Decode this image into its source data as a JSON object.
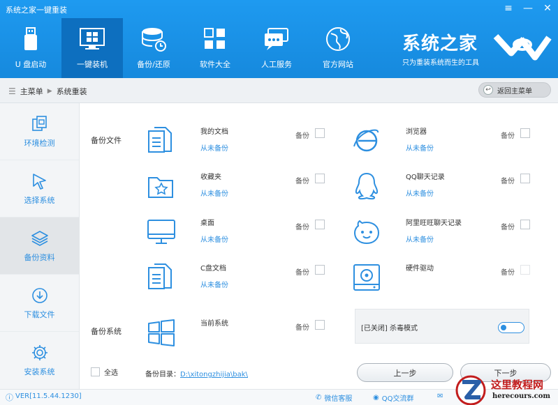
{
  "window": {
    "title": "系统之家一键重装"
  },
  "nav": [
    {
      "label": "U 盘启动",
      "icon": "usb-icon"
    },
    {
      "label": "一键装机",
      "icon": "monitor-windows-icon"
    },
    {
      "label": "备份/还原",
      "icon": "database-restore-icon"
    },
    {
      "label": "软件大全",
      "icon": "apps-grid-icon"
    },
    {
      "label": "人工服务",
      "icon": "chat-bubbles-icon"
    },
    {
      "label": "官方网站",
      "icon": "globe-icon"
    }
  ],
  "brand": {
    "name": "系统之家",
    "slogan": "只为重装系统而生的工具"
  },
  "breadcrumb": {
    "home": "主菜单",
    "current": "系统重装"
  },
  "back_button": "返回主菜单",
  "sidebar": [
    {
      "label": "环境检测",
      "icon": "copy-pages-icon"
    },
    {
      "label": "选择系统",
      "icon": "cursor-arrow-icon"
    },
    {
      "label": "备份资料",
      "icon": "layers-icon"
    },
    {
      "label": "下载文件",
      "icon": "download-circle-icon"
    },
    {
      "label": "安装系统",
      "icon": "gear-icon"
    }
  ],
  "backup_files": {
    "section_label": "备份文件",
    "backup_label": "备份",
    "items": [
      {
        "name": "我的文档",
        "status": "从未备份",
        "icon": "documents-icon"
      },
      {
        "name": "浏览器",
        "status": "从未备份",
        "icon": "ie-browser-icon"
      },
      {
        "name": "收藏夹",
        "status": "从未备份",
        "icon": "favorites-folder-icon"
      },
      {
        "name": "QQ聊天记录",
        "status": "从未备份",
        "icon": "qq-penguin-icon"
      },
      {
        "name": "桌面",
        "status": "从未备份",
        "icon": "desktop-monitor-icon"
      },
      {
        "name": "阿里旺旺聊天记录",
        "status": "从未备份",
        "icon": "wangwang-icon"
      },
      {
        "name": "C盘文档",
        "status": "从未备份",
        "icon": "c-drive-documents-icon"
      },
      {
        "name": "硬件驱动",
        "status": "",
        "icon": "hardware-driver-icon"
      }
    ]
  },
  "backup_system": {
    "section_label": "备份系统",
    "name": "当前系统",
    "backup_label": "备份",
    "icon": "windows-logo-icon"
  },
  "antivirus": {
    "text": "[已关闭] 杀毒模式"
  },
  "footer": {
    "select_all": "全选",
    "dir_label": "备份目录：",
    "dir_path": "D:\\xitongzhijia\\bak\\",
    "prev_button": "上一步",
    "next_button": "下一步"
  },
  "statusbar": {
    "version": "VER[11.5.44.1230]",
    "wechat": "微信客服",
    "qq": "QQ交流群",
    "feedback": ""
  },
  "watermark": {
    "text": "这里教程网",
    "url": "herecours.com"
  }
}
